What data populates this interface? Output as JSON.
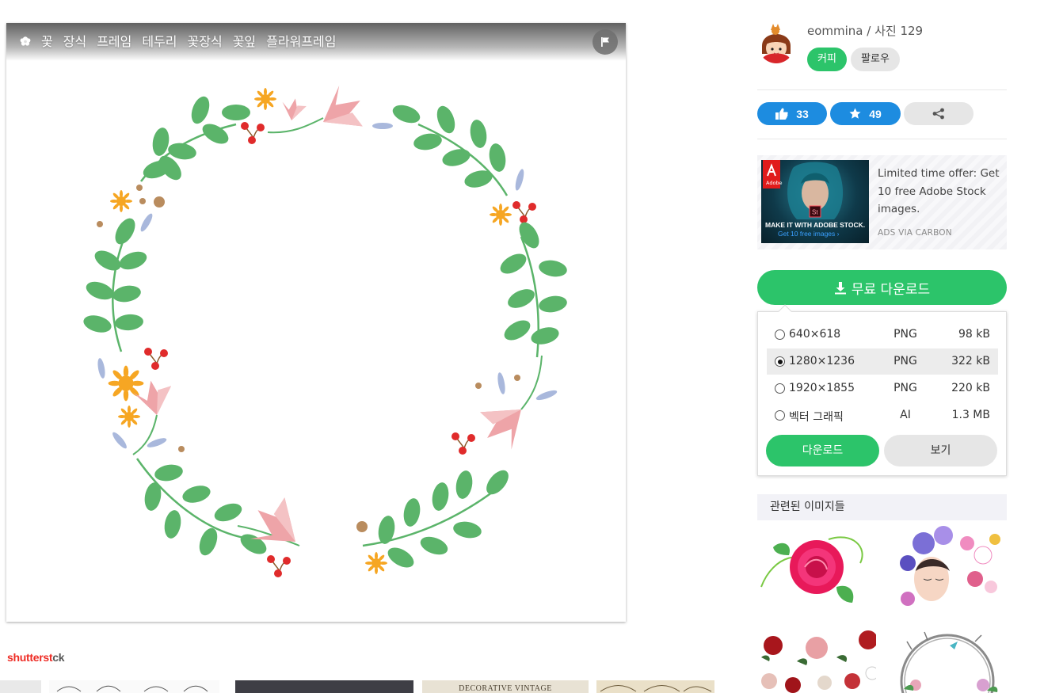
{
  "tags": [
    "꽃",
    "장식",
    "프레임",
    "테두리",
    "꽃장식",
    "꽃잎",
    "플라워프레임"
  ],
  "icons": {
    "tag": "tag-icon",
    "flag": "flag-icon",
    "like": "thumbs-up-icon",
    "star": "star-icon",
    "share": "share-icon",
    "download": "download-icon"
  },
  "sponsor": {
    "brand_red": "shutterst",
    "brand_grey": "ck",
    "strip_text": "DECORATIVE VINTAGE"
  },
  "author": {
    "line": "eommina / 사진 129",
    "copy_button": "커피",
    "follow_button": "팔로우"
  },
  "actions": {
    "likes": "33",
    "stars": "49"
  },
  "ad": {
    "headline": "MAKE IT WITH ADOBE STOCK.",
    "cta": "Get 10 free images ›",
    "brand": "Adobe",
    "app_icon": "St",
    "text": "Limited time offer: Get 10 free Adobe Stock images.",
    "via": "ADS VIA CARBON"
  },
  "download": {
    "main_label": "무료 다운로드",
    "options": [
      {
        "dims": "640×618",
        "format": "PNG",
        "size": "98 kB",
        "selected": false
      },
      {
        "dims": "1280×1236",
        "format": "PNG",
        "size": "322 kB",
        "selected": true
      },
      {
        "dims": "1920×1855",
        "format": "PNG",
        "size": "220 kB",
        "selected": false
      },
      {
        "dims": "벡터 그래픽",
        "format": "AI",
        "size": "1.3 MB",
        "selected": false
      }
    ],
    "download_button": "다운로드",
    "view_button": "보기"
  },
  "related": {
    "heading": "관련된 이미지들"
  },
  "colors": {
    "green": "#2cc46a",
    "blue": "#1d8ce0",
    "leaf": "#5bb46a",
    "petal": "#eea4a8",
    "berry": "#e02b2b",
    "sun": "#f6a623"
  }
}
